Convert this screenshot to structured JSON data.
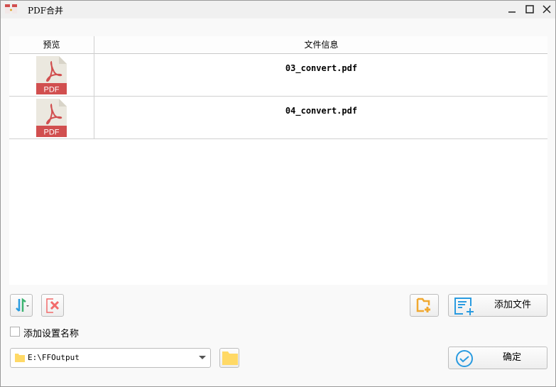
{
  "window": {
    "title": "PDF合并"
  },
  "table": {
    "headers": [
      "预览",
      "文件信息"
    ],
    "rows": [
      {
        "icon_label": "PDF",
        "file_name": "03_convert.pdf"
      },
      {
        "icon_label": "PDF",
        "file_name": "04_convert.pdf"
      }
    ]
  },
  "toolbar": {
    "add_file_label": "添加文件",
    "confirm_label": "确定"
  },
  "options": {
    "add_name_label": "添加设置名称",
    "add_name_checked": false
  },
  "output": {
    "path": "E:\\FFOutput"
  },
  "colors": {
    "pdf_red": "#d14f4f",
    "accent_blue": "#2a9be0",
    "folder_yellow": "#ffd966",
    "orange": "#f0a830"
  }
}
